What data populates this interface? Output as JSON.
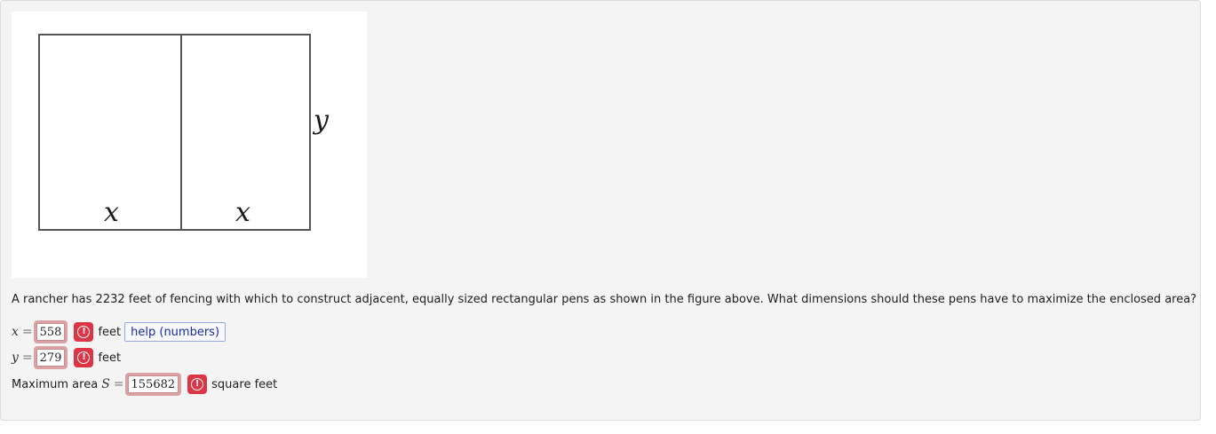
{
  "figure": {
    "label_x_left": "x",
    "label_x_right": "x",
    "label_y": "y"
  },
  "question": "A rancher has 2232 feet of fencing with which to construct adjacent, equally sized rectangular pens as shown in the figure above. What dimensions should these pens have to maximize the enclosed area?",
  "answers": {
    "x": {
      "var": "x",
      "eq": "=",
      "value": "558",
      "unit": "feet",
      "help_label": "help (numbers)"
    },
    "y": {
      "var": "y",
      "eq": "=",
      "value": "279",
      "unit": "feet"
    },
    "area": {
      "prefix": "Maximum area",
      "var": "S",
      "eq": "=",
      "value": "155682",
      "unit": "square feet"
    }
  },
  "colors": {
    "error": "#dc3545",
    "answer_border": "#d9a3a6",
    "panel_bg": "#f4f4f4"
  },
  "icons": {
    "error": "exclamation-circle-icon"
  }
}
